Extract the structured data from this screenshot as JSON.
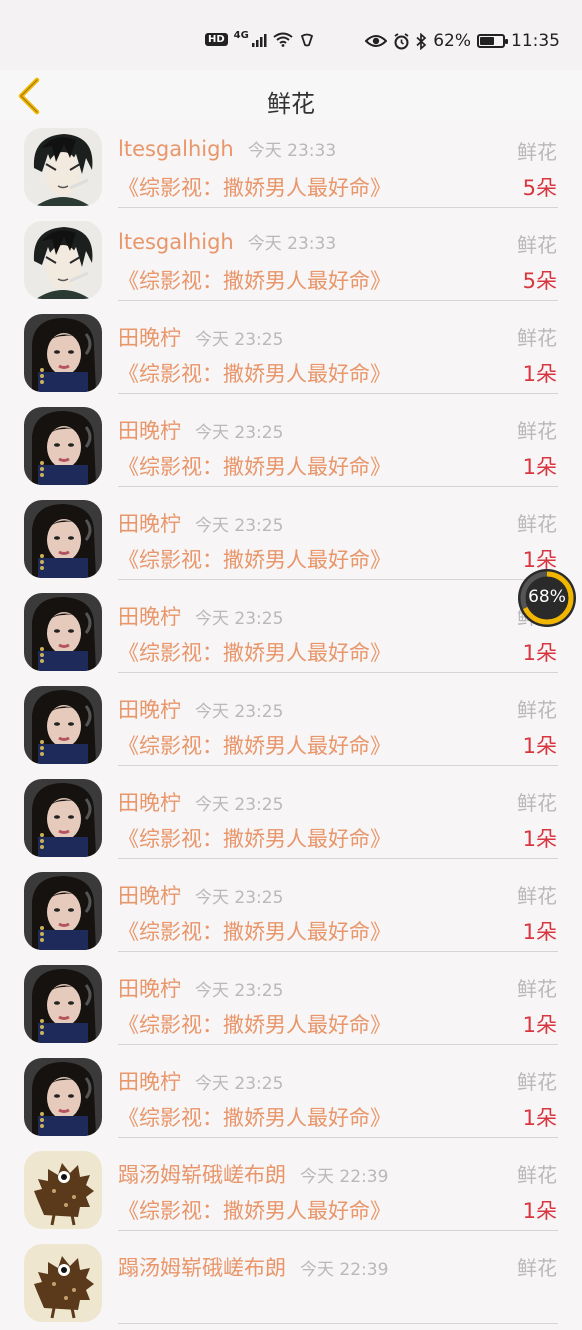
{
  "status_bar": {
    "network_badge": "HD",
    "network_type": "4G",
    "battery_percent": "62%",
    "battery_level": 0.62,
    "time": "11:35",
    "icons": [
      "signal-icon",
      "wifi-icon",
      "eye-icon",
      "alarm-icon",
      "bluetooth-icon",
      "battery-icon"
    ]
  },
  "header": {
    "title": "鲜花",
    "back_icon": "chevron-left-icon",
    "accent_color": "#f2b600"
  },
  "rows": [
    {
      "name": "ltesgalhigh",
      "time": "今天 23:33",
      "gift": "鲜花",
      "book": "《综影视：撒娇男人最好命》",
      "count": "5朵",
      "avatar": "male-avatar"
    },
    {
      "name": "ltesgalhigh",
      "time": "今天 23:33",
      "gift": "鲜花",
      "book": "《综影视：撒娇男人最好命》",
      "count": "5朵",
      "avatar": "male-avatar"
    },
    {
      "name": "田晚柠",
      "time": "今天 23:25",
      "gift": "鲜花",
      "book": "《综影视：撒娇男人最好命》",
      "count": "1朵",
      "avatar": "female-avatar"
    },
    {
      "name": "田晚柠",
      "time": "今天 23:25",
      "gift": "鲜花",
      "book": "《综影视：撒娇男人最好命》",
      "count": "1朵",
      "avatar": "female-avatar"
    },
    {
      "name": "田晚柠",
      "time": "今天 23:25",
      "gift": "鲜花",
      "book": "《综影视：撒娇男人最好命》",
      "count": "1朵",
      "avatar": "female-avatar"
    },
    {
      "name": "田晚柠",
      "time": "今天 23:25",
      "gift": "鲜花",
      "book": "《综影视：撒娇男人最好命》",
      "count": "1朵",
      "avatar": "female-avatar"
    },
    {
      "name": "田晚柠",
      "time": "今天 23:25",
      "gift": "鲜花",
      "book": "《综影视：撒娇男人最好命》",
      "count": "1朵",
      "avatar": "female-avatar"
    },
    {
      "name": "田晚柠",
      "time": "今天 23:25",
      "gift": "鲜花",
      "book": "《综影视：撒娇男人最好命》",
      "count": "1朵",
      "avatar": "female-avatar"
    },
    {
      "name": "田晚柠",
      "time": "今天 23:25",
      "gift": "鲜花",
      "book": "《综影视：撒娇男人最好命》",
      "count": "1朵",
      "avatar": "female-avatar"
    },
    {
      "name": "田晚柠",
      "time": "今天 23:25",
      "gift": "鲜花",
      "book": "《综影视：撒娇男人最好命》",
      "count": "1朵",
      "avatar": "female-avatar"
    },
    {
      "name": "田晚柠",
      "time": "今天 23:25",
      "gift": "鲜花",
      "book": "《综影视：撒娇男人最好命》",
      "count": "1朵",
      "avatar": "female-avatar"
    },
    {
      "name": "蹋汤姆崭硪嵯布朗",
      "time": "今天 22:39",
      "gift": "鲜花",
      "book": "《综影视：撒娇男人最好命》",
      "count": "1朵",
      "avatar": "hedgehog-avatar"
    },
    {
      "name": "蹋汤姆崭硪嵯布朗",
      "time": "今天 22:39",
      "gift": "鲜花",
      "book": "",
      "count": "",
      "avatar": "hedgehog-avatar"
    }
  ],
  "floating_badge": {
    "label": "68%",
    "level": 0.68,
    "ring_color": "#f2b600"
  },
  "colors": {
    "name_text": "#e8966a",
    "muted_text": "#b9b9b9",
    "count_text": "#d8363f"
  }
}
